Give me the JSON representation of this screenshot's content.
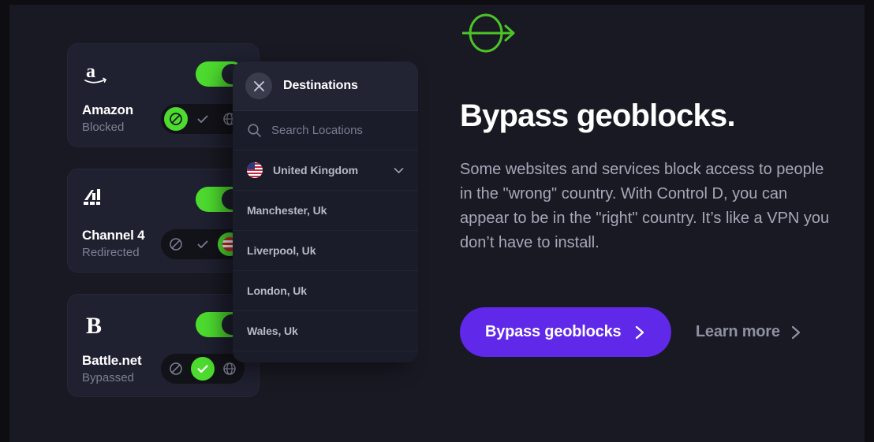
{
  "brand": {
    "logo_icon": "control-d-arrow-logo"
  },
  "cards": [
    {
      "logo_icon": "amazon-logo",
      "name": "Amazon",
      "status": "Blocked",
      "toggle_on": true,
      "active_action": "block",
      "actions": [
        "block-icon",
        "check-icon",
        "globe-icon"
      ]
    },
    {
      "logo_icon": "channel-4-logo",
      "name": "Channel 4",
      "status": "Redirected",
      "toggle_on": true,
      "active_action": "redirect",
      "actions": [
        "block-icon",
        "check-icon",
        "flag-icon"
      ]
    },
    {
      "logo_icon": "battle-net-logo",
      "name": "Battle.net",
      "status": "Bypassed",
      "toggle_on": true,
      "active_action": "allow",
      "actions": [
        "block-icon",
        "check-icon",
        "globe-icon"
      ]
    }
  ],
  "destinations": {
    "title": "Destinations",
    "close_icon": "close-icon",
    "search": {
      "icon": "search-icon",
      "placeholder": "Search Locations",
      "value": ""
    },
    "country": {
      "flag_icon": "us-flag-icon",
      "name": "United Kingdom",
      "chevron_icon": "chevron-down-icon"
    },
    "locations": [
      "Manchester, Uk",
      "Liverpool, Uk",
      "London, Uk",
      "Wales, Uk"
    ]
  },
  "hero": {
    "title": "Bypass geoblocks.",
    "body": "Some websites and services block access to people in the \"wrong\" country. With Control D, you can appear to be in the \"right\" country. It’s like a VPN you don’t have to install.",
    "cta_label": "Bypass geoblocks",
    "cta_icon": "chevron-right-icon",
    "learn_more_label": "Learn more",
    "learn_more_icon": "chevron-right-icon"
  },
  "colors": {
    "background": "#191923",
    "card": "#1f2030",
    "accent_green": "#4ddb2f",
    "accent_purple": "#6028e8",
    "panel": "#1b1c29",
    "text_muted": "#a5a8b8"
  }
}
